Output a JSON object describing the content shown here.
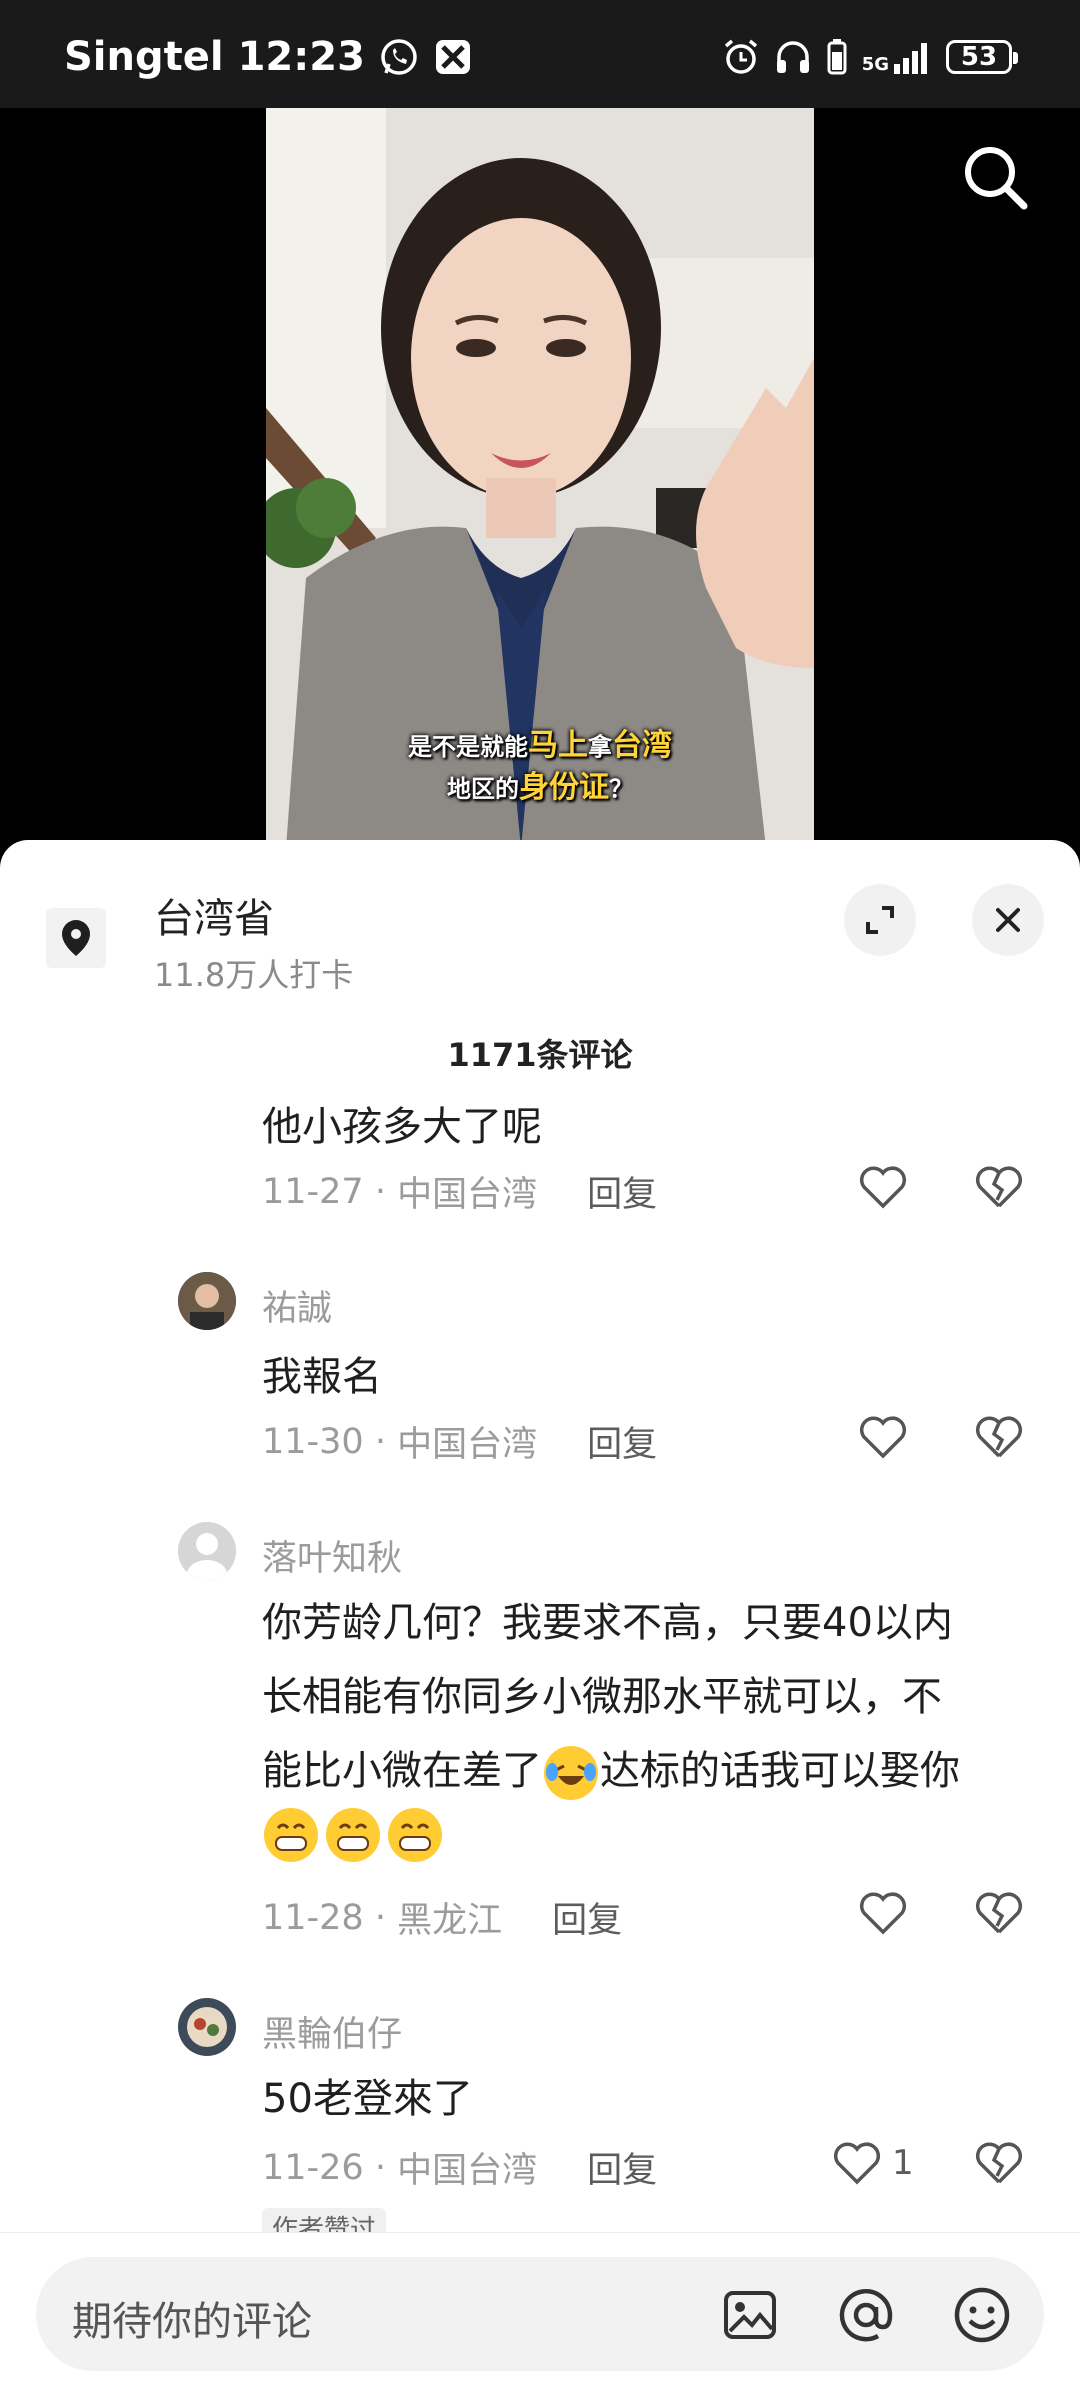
{
  "status_bar": {
    "carrier": "Singtel",
    "time": "12:23",
    "network": "5G",
    "battery": "53"
  },
  "video": {
    "subtitle_line1": [
      "是不是就能",
      "马上",
      "拿",
      "台湾"
    ],
    "subtitle_line2": [
      "地区的",
      "身份证",
      "？"
    ]
  },
  "location": {
    "title": "台湾省",
    "subtitle": "11.8万人打卡"
  },
  "comments_count": "1171条评论",
  "comments": [
    {
      "username": "",
      "text": "他小孩多大了呢",
      "date": "11-27",
      "region": "中国台湾",
      "reply": "回复",
      "likes": ""
    },
    {
      "username": "祐誠",
      "text": "我報名",
      "date": "11-30",
      "region": "中国台湾",
      "reply": "回复",
      "likes": ""
    },
    {
      "username": "落叶知秋",
      "text_lines": [
        "你芳龄几何？我要求不高，只要40以内",
        "长相能有你同乡小微那水平就可以，不",
        "能比小微在差了",
        "达标的话我可以娶你"
      ],
      "date": "11-28",
      "region": "黑龙江",
      "reply": "回复",
      "likes": ""
    },
    {
      "username": "黑輪伯仔",
      "text": "50老登來了",
      "date": "11-26",
      "region": "中国台湾",
      "reply": "回复",
      "likes": "1",
      "tag": "作者赞过"
    }
  ],
  "input": {
    "placeholder": "期待你的评论"
  },
  "colors": {
    "accent_yellow": "#ffd43a",
    "sheet_bg": "#ffffff",
    "muted_text": "#9b9b9b"
  }
}
